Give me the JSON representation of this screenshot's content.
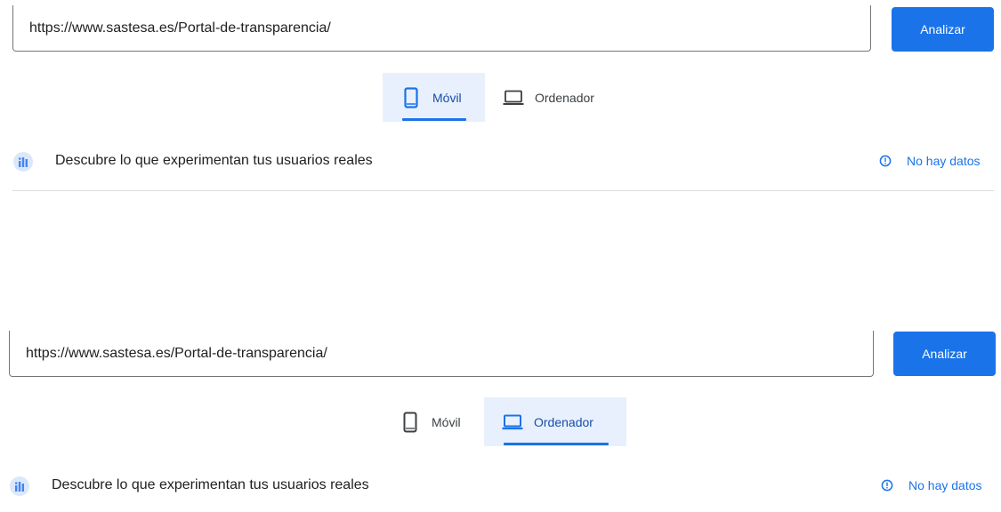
{
  "panels": [
    {
      "url_value": "https://www.sastesa.es/Portal-de-transparencia/",
      "analyze_label": "Analizar",
      "tabs": [
        {
          "label": "Móvil",
          "icon": "smartphone-icon",
          "active": true
        },
        {
          "label": "Ordenador",
          "icon": "laptop-icon",
          "active": false
        }
      ],
      "crux": {
        "title": "Descubre lo que experimentan tus usuarios reales",
        "icon": "crux-users-icon",
        "status_label": "No hay datos",
        "status_icon": "info-icon"
      }
    },
    {
      "url_value": "https://www.sastesa.es/Portal-de-transparencia/",
      "analyze_label": "Analizar",
      "tabs": [
        {
          "label": "Móvil",
          "icon": "smartphone-icon",
          "active": false
        },
        {
          "label": "Ordenador",
          "icon": "laptop-icon",
          "active": true
        }
      ],
      "crux": {
        "title": "Descubre lo que experimentan tus usuarios reales",
        "icon": "crux-users-icon",
        "status_label": "No hay datos",
        "status_icon": "info-icon"
      }
    }
  ],
  "colors": {
    "accent": "#1a73e8",
    "active_tab_bg": "#e8f0fe",
    "active_tab_text": "#174ea6",
    "divider": "#dadce0"
  }
}
